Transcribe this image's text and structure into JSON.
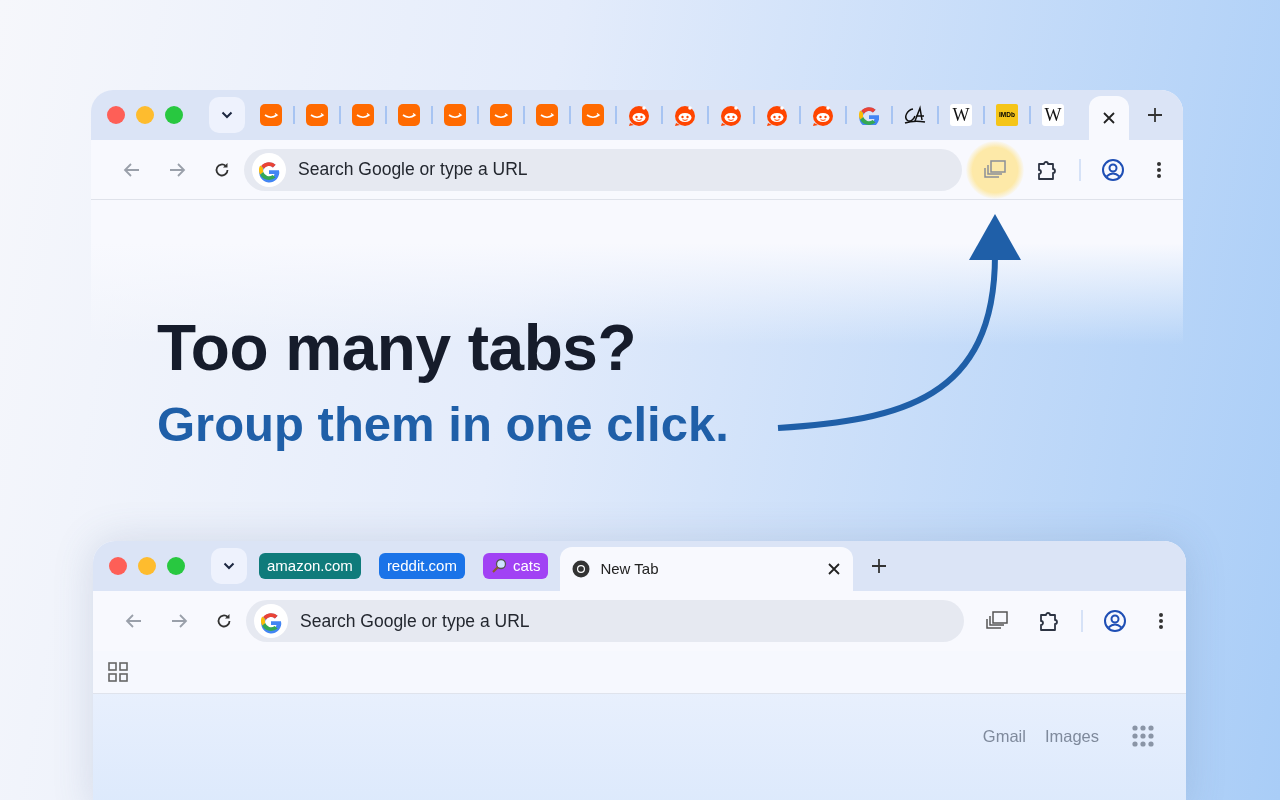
{
  "top_window": {
    "tabs": [
      {
        "kind": "amazon",
        "selected": false
      },
      {
        "kind": "amazon",
        "selected": false
      },
      {
        "kind": "amazon",
        "selected": false
      },
      {
        "kind": "amazon",
        "selected": false
      },
      {
        "kind": "amazon",
        "selected": false
      },
      {
        "kind": "amazon",
        "selected": false
      },
      {
        "kind": "amazon",
        "selected": false
      },
      {
        "kind": "amazon",
        "selected": false
      },
      {
        "kind": "reddit",
        "selected": false
      },
      {
        "kind": "reddit",
        "selected": false
      },
      {
        "kind": "reddit",
        "selected": false
      },
      {
        "kind": "reddit",
        "selected": false
      },
      {
        "kind": "reddit",
        "selected": false
      },
      {
        "kind": "google",
        "selected": false
      },
      {
        "kind": "script",
        "selected": false
      },
      {
        "kind": "wiki",
        "label": "W",
        "selected": false
      },
      {
        "kind": "imdb",
        "label": "IMDb",
        "selected": false
      },
      {
        "kind": "wiki",
        "label": "W",
        "selected": false
      },
      {
        "kind": "blank",
        "selected": true
      }
    ],
    "omnibox": {
      "placeholder": "Search Google or type a URL"
    },
    "group_button_highlighted": true
  },
  "headline": "Too many tabs?",
  "subheadline": "Group them in one click.",
  "bottom_window": {
    "tab_groups": [
      {
        "label": "amazon.com",
        "color": "#0f7b7b",
        "kind": "plain"
      },
      {
        "label": "reddit.com",
        "color": "#1a73e8",
        "kind": "plain"
      },
      {
        "label": "cats",
        "color": "#a142f4",
        "kind": "search"
      }
    ],
    "tabs": [
      {
        "title": "New Tab",
        "selected": true
      }
    ],
    "omnibox": {
      "placeholder": "Search Google or type a URL"
    },
    "group_button_highlighted": false,
    "links": [
      "Gmail",
      "Images"
    ]
  }
}
